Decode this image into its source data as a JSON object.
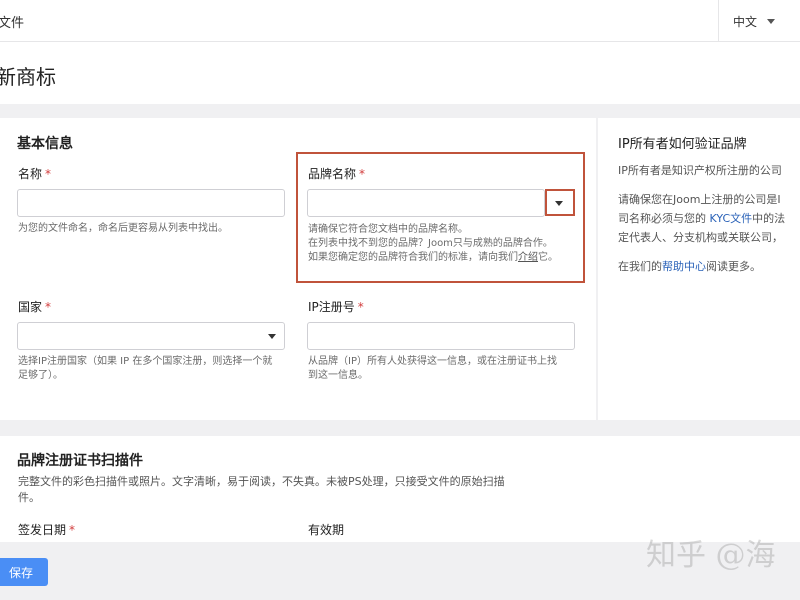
{
  "header": {
    "breadcrumb": "文件",
    "language": "中文",
    "page_title": "新商标"
  },
  "basic_info": {
    "section_title": "基本信息",
    "name_label": "名称",
    "name_help": "为您的文件命名，命名后更容易从列表中找出。",
    "brand_label": "品牌名称",
    "brand_help_line1": "请确保它符合您文档中的品牌名称。",
    "brand_help_line2": "在列表中找不到您的品牌？Joom只与成熟的品牌合作。",
    "brand_help_line3_pre": "如果您确定您的品牌符合我们的标准，请向我们",
    "brand_help_link": "介绍",
    "brand_help_line3_post": "它。",
    "country_label": "国家",
    "country_help_line1": "选择IP注册国家（如果 IP 在多个国家注册，则选择一个就",
    "country_help_line2": "足够了）。",
    "ip_label": "IP注册号",
    "ip_help_line1": "从品牌（IP）所有人处获得这一信息，或在注册证书上找",
    "ip_help_line2": "到这一信息。",
    "required_mark": "*"
  },
  "sidebar": {
    "title": "IP所有者如何验证品牌",
    "line1": "IP所有者是知识产权所注册的公司",
    "line2_pre": "请确保您在Joom上注册的公司是I",
    "line3_pre": "司名称必须与您的 ",
    "line3_link": "KYC文件",
    "line3_post": "中的法",
    "line4": "定代表人、分支机构或关联公司，",
    "line5_pre": "在我们的",
    "line5_link": "帮助中心",
    "line5_post": "阅读更多。"
  },
  "scan": {
    "section_title": "品牌注册证书扫描件",
    "desc_line1": "完整文件的彩色扫描件或照片。文字清晰，易于阅读，不失真。未被PS处理，只接受文件的原始扫描",
    "desc_line2": "件。",
    "issue_date_label": "签发日期",
    "expiry_label": "有效期"
  },
  "actions": {
    "save_label": "保存"
  },
  "watermark": "知乎 @海",
  "colors": {
    "accent": "#4a8ef5",
    "highlight": "#c0533b",
    "link": "#2a62b8",
    "required": "#d23c3c"
  }
}
